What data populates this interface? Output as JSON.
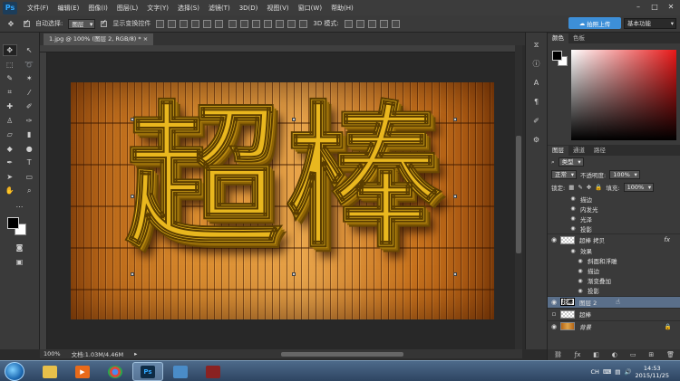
{
  "app": {
    "logo": "Ps"
  },
  "menu": [
    "文件(F)",
    "编辑(E)",
    "图像(I)",
    "图层(L)",
    "文字(Y)",
    "选择(S)",
    "滤镜(T)",
    "3D(D)",
    "视图(V)",
    "窗口(W)",
    "帮助(H)"
  ],
  "window_controls": [
    "–",
    "□",
    "✕"
  ],
  "options": {
    "auto_select_label": "自动选择:",
    "auto_select_value": "图层",
    "show_transform_label": "显示变换控件",
    "mode_3d_label": "3D 模式:",
    "cloud_button": "拍照上传",
    "workspace": "基本功能"
  },
  "document": {
    "tab_title": "1.jpg @ 100% (图层 2, RGB/8) *",
    "tab_close": "×",
    "zoom": "100%",
    "doc_info": "文档:1.03M/4.46M",
    "image_text": "超棒"
  },
  "panels": {
    "color_tabs": [
      "颜色",
      "色板"
    ],
    "layers_tabs": [
      "图层",
      "通道",
      "路径"
    ],
    "kind_select": "类型",
    "blend_mode": "正常",
    "opacity_label": "不透明度:",
    "opacity_value": "100%",
    "lock_label": "锁定:",
    "fill_label": "填充:",
    "fill_value": "100%",
    "layers": [
      {
        "type": "effect",
        "name": "描边"
      },
      {
        "type": "effect",
        "name": "内发光"
      },
      {
        "type": "effect",
        "name": "光泽"
      },
      {
        "type": "effect",
        "name": "投影"
      },
      {
        "type": "layer",
        "name": "超棒 拷贝",
        "fx": "fx"
      },
      {
        "type": "effect",
        "name": "效果"
      },
      {
        "type": "effect",
        "name": "斜面和浮雕"
      },
      {
        "type": "effect",
        "name": "描边"
      },
      {
        "type": "effect",
        "name": "渐变叠加"
      },
      {
        "type": "effect",
        "name": "投影"
      },
      {
        "type": "layer",
        "name": "图层 2",
        "thumb_text": "超棒",
        "selected": true
      },
      {
        "type": "layer",
        "name": "超棒"
      },
      {
        "type": "layer",
        "name": "背景",
        "lock": "🔒"
      }
    ],
    "bottom_icons": [
      "link-icon",
      "fx-icon",
      "mask-icon",
      "adjustment-icon",
      "group-icon",
      "new-layer-icon",
      "trash-icon"
    ]
  },
  "taskbar": {
    "time": "14:53",
    "date": "2015/11/25",
    "ime": "CH"
  }
}
